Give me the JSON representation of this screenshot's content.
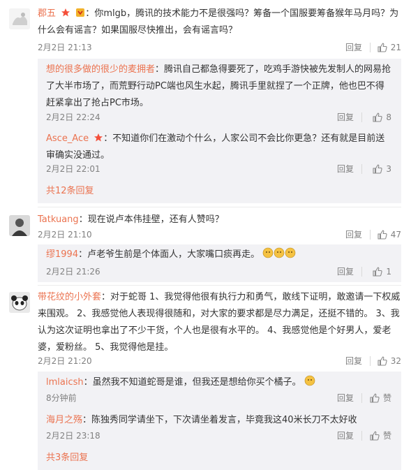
{
  "ui": {
    "reply_label": "回复",
    "like_icon": "thumb-up-icon",
    "accent": "#eb7350"
  },
  "comments": [
    {
      "user": "郡五",
      "text": "你mlgb，腾讯的技术能力不是很强吗？筹备一个国服要筹备猴年马月吗？为什么会有谣言？如果国服尽快推出，会有谣言吗？",
      "time": "2月2日 21:13",
      "likes": "21",
      "replies": [
        {
          "user": "想的很多做的很少的麦拥者",
          "text": "腾讯自己都急得要死了，吃鸡手游快被先发制人的网易抢了大半市场了，而荒野行动PC端也风生水起，腾讯手里就捏了一个正牌，他也巴不得赶紧拿出了抢占PC市场。",
          "time": "2月2日 22:24",
          "likes": "8"
        },
        {
          "user": "Asce_Ace",
          "text": "不知道你们在激动个什么，人家公司不会比你更急？还有就是目前送审确实没通过。",
          "time": "2月2日 22:01",
          "likes": "3"
        }
      ],
      "more": "共12条回复"
    },
    {
      "user": "Tatkuang",
      "text": "现在说卢本伟挂壁，还有人赞吗？",
      "time": "2月2日 21:10",
      "likes": "47",
      "replies": [
        {
          "user": "缪1994",
          "text": "卢老爷生前是个体面人，大家嘴口痰再走。",
          "time": "2月2日 21:26",
          "likes": "1"
        }
      ]
    },
    {
      "user": "带花纹的小外套",
      "text": "对于蛇哥 1、我觉得他很有执行力和勇气，敢线下证明，敢邀请一下权威来围观。 2、我感觉他人表现得很随和，对大家的要求都是尽力满足，还挺不错的。 3、我认为这次证明也拿出了不少干货，个人也是很有水平的。 4、我感觉他是个好男人，爱老婆，爱粉丝。 5、我觉得他是挂。",
      "time": "2月2日 21:20",
      "likes": "32",
      "replies": [
        {
          "user": "lmlaicsh",
          "text": "虽然我不知道蛇哥是谁，但我还是想给你买个橘子。",
          "time": "8分钟前",
          "likes": "赞"
        },
        {
          "user": "海月之殇",
          "text": "陈独秀同学请坐下，下次请坐着发言，毕竟我这40米长刀不太好收",
          "time": "2月2日 23:18",
          "likes": "赞"
        }
      ],
      "more": "共3条回复"
    }
  ]
}
